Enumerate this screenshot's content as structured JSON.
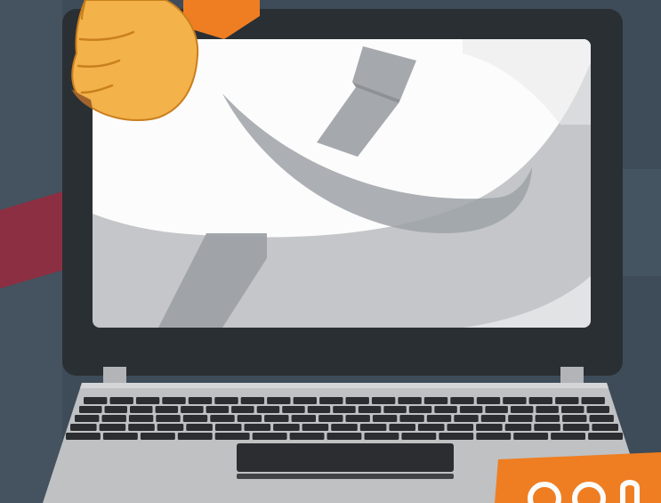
{
  "colors": {
    "background": "#3d4c58",
    "background_panel": "#4a5a66",
    "laptop_bezel": "#2a2f34",
    "screen_white": "#fcfcfc",
    "screen_gray": "#c4c6c9",
    "shadow_gray": "#9ea2a7",
    "laptop_body": "#bfc1c3",
    "key": "#2b2d30",
    "trackpad": "#2b2d30",
    "hand_skin": "#f3b24a",
    "hand_outline": "#c97f1e",
    "accent_orange": "#ef7e22",
    "accent_maroon": "#8c2f42"
  },
  "icons": {
    "hand": "hand-icon",
    "tie": "necktie-icon"
  },
  "keyboard": {
    "rows": 5,
    "keys_per_row": [
      20,
      21,
      20,
      19,
      15
    ]
  }
}
